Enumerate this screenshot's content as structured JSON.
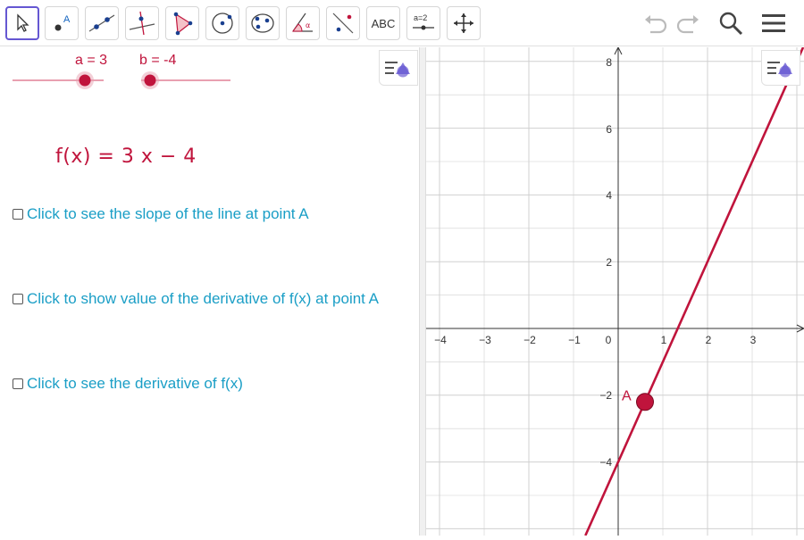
{
  "toolbar": {
    "tools": [
      {
        "name": "move-tool"
      },
      {
        "name": "point-tool",
        "label": "A"
      },
      {
        "name": "line-tool"
      },
      {
        "name": "perpendicular-line-tool"
      },
      {
        "name": "polygon-tool"
      },
      {
        "name": "circle-tool"
      },
      {
        "name": "conic-tool"
      },
      {
        "name": "angle-tool",
        "label": "α"
      },
      {
        "name": "reflect-tool"
      },
      {
        "name": "text-tool",
        "label": "ABC"
      },
      {
        "name": "slider-tool",
        "label": "a=2"
      },
      {
        "name": "move-graphics-view-tool"
      }
    ]
  },
  "algebra": {
    "slider_a": {
      "label": "a = 3",
      "value": 3,
      "min": -5,
      "max": 5
    },
    "slider_b": {
      "label": "b = -4",
      "value": -4,
      "min": -5,
      "max": 5
    },
    "function": "f(x) = 3 x − 4",
    "checkboxes": [
      {
        "label": "Click to see the slope of the line at point A",
        "checked": false
      },
      {
        "label": "Click to show value of the derivative of f(x) at point A",
        "checked": false
      },
      {
        "label": "Click to see the derivative of f(x)",
        "checked": false
      }
    ]
  },
  "graph": {
    "x_ticks": [
      "−4",
      "−3",
      "−2",
      "−1",
      "0",
      "1",
      "2",
      "3"
    ],
    "y_ticks": [
      "8",
      "6",
      "4",
      "2",
      "−2",
      "−4"
    ],
    "point_label": "A",
    "point_x": 0.6,
    "point_y": -2.2,
    "line_slope": 3,
    "line_intercept": -4,
    "colors": {
      "function": "#c0143c",
      "grid": "#d0d0d0",
      "accent": "#6557d2",
      "link": "#1a9ec6"
    }
  }
}
